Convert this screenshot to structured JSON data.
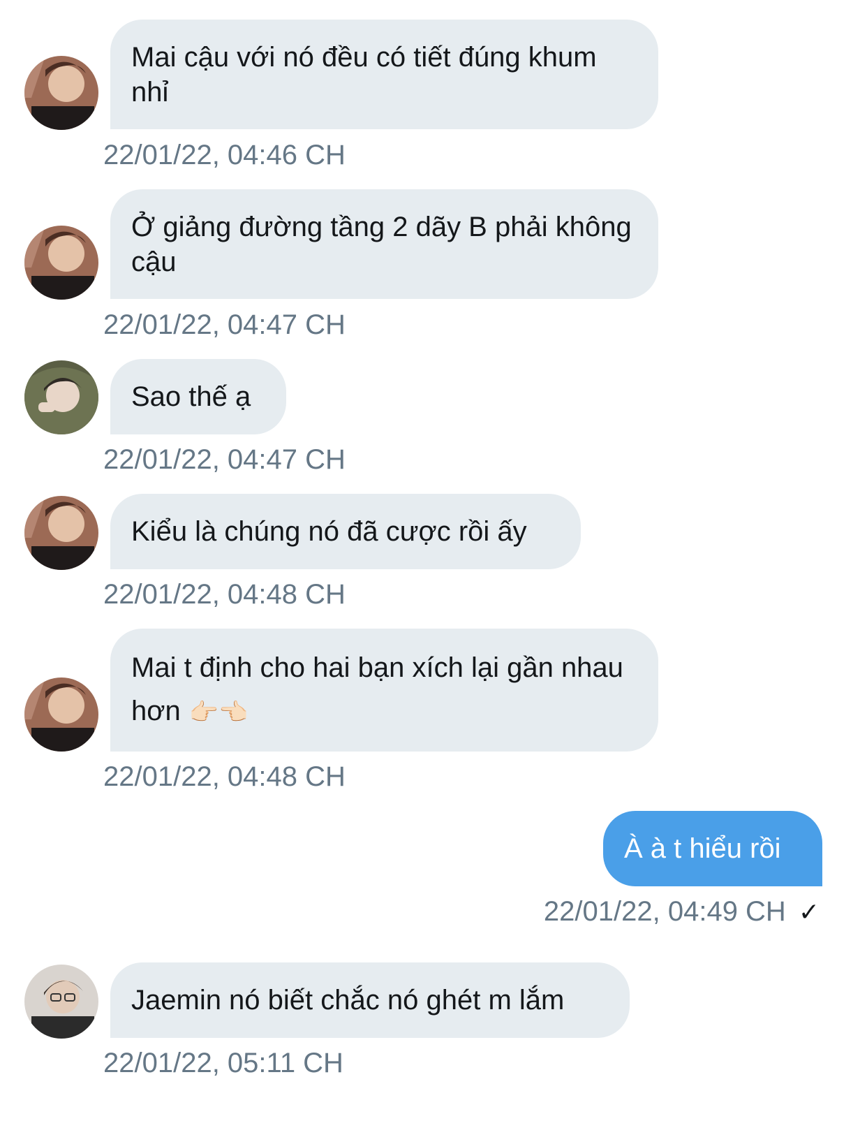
{
  "conversation": {
    "messages": [
      {
        "text": "Mai cậu với nó đều có tiết đúng khum nhỉ",
        "time": "22/01/22, 04:46 CH",
        "sender": "other"
      },
      {
        "text": "Ở giảng đường tầng 2 dãy B phải không cậu",
        "time": "22/01/22, 04:47 CH",
        "sender": "other"
      },
      {
        "text": "Sao thế ạ",
        "time": "22/01/22, 04:47 CH",
        "sender": "other"
      },
      {
        "text": "Kiểu là chúng nó đã cược rồi ấy",
        "time": "22/01/22, 04:48 CH",
        "sender": "other"
      },
      {
        "text": "Mai t định cho hai bạn xích lại gần nhau hơn",
        "emoji": "👉🏻👈🏻",
        "time": "22/01/22, 04:48 CH",
        "sender": "other"
      },
      {
        "text": "À à t hiểu rồi",
        "time": "22/01/22, 04:49 CH",
        "sender": "me",
        "status": "✓"
      },
      {
        "text": "Jaemin nó biết chắc nó ghét m lắm",
        "time": "22/01/22, 05:11 CH",
        "sender": "other"
      }
    ]
  },
  "colors": {
    "incoming_bubble": "#e6ecf0",
    "outgoing_bubble": "#4a9fe8",
    "timestamp": "#657786",
    "text": "#14171a"
  },
  "icons": {
    "sent_status": "checkmark-icon",
    "avatar": "user-avatar"
  }
}
